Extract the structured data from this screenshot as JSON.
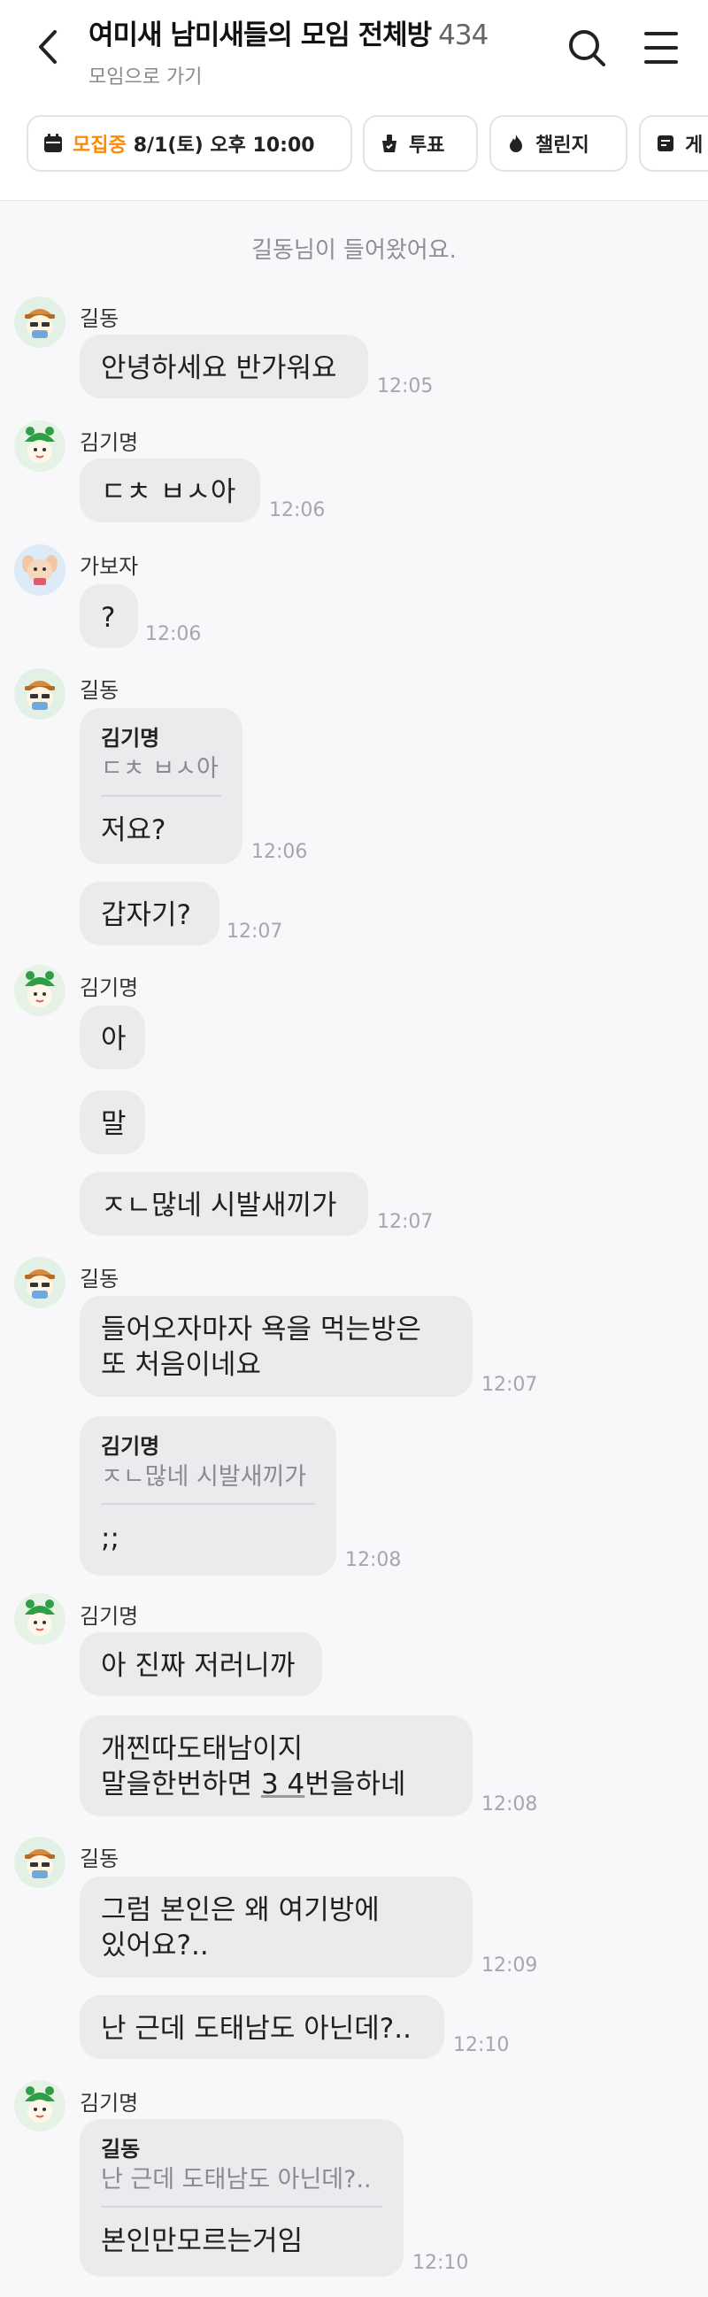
{
  "header": {
    "title": "여미새 남미새들의 모임 전체방",
    "member_count": "434",
    "subtitle": "모임으로 가기"
  },
  "chips": [
    {
      "highlight": "모집중",
      "label": "8/1(토) 오후 10:00",
      "icon": "calendar-icon"
    },
    {
      "label": "투표",
      "icon": "vote-icon"
    },
    {
      "label": "챌린지",
      "icon": "flame-icon"
    },
    {
      "label": "게",
      "icon": "board-icon"
    }
  ],
  "system_message": "길동님이 들어왔어요.",
  "messages": [
    {
      "sender": "길동",
      "text": "안녕하세요 반가워요",
      "time": "12:05"
    },
    {
      "sender": "김기명",
      "text": "ㄷㅊ ㅂㅅ아",
      "time": "12:06"
    },
    {
      "sender": "가보자",
      "text": "?",
      "time": "12:06"
    },
    {
      "sender": "길동",
      "reply_to": "김기명",
      "reply_text": "ㄷㅊ ㅂㅅ아",
      "text": "저요?",
      "time": "12:06"
    },
    {
      "sender": "길동",
      "text": "갑자기?",
      "time": "12:07"
    },
    {
      "sender": "김기명",
      "text": "아"
    },
    {
      "sender": "김기명",
      "text": "말"
    },
    {
      "sender": "김기명",
      "text": "ㅈㄴ많네 시발새끼가",
      "time": "12:07"
    },
    {
      "sender": "길동",
      "text_line1": "들어오자마자 욕을 먹는방은",
      "text_line2": "또 처음이네요",
      "time": "12:07"
    },
    {
      "sender": "길동",
      "reply_to": "김기명",
      "reply_text": "ㅈㄴ많네 시발새끼가",
      "text": ";;",
      "time": "12:08"
    },
    {
      "sender": "김기명",
      "text": "아 진짜 저러니까"
    },
    {
      "sender": "김기명",
      "text_line1": "개찐따도태남이지",
      "text_line2_a": "말을한번하면 ",
      "text_line2_b": "3 4",
      "text_line2_c": "번을하네",
      "time": "12:08"
    },
    {
      "sender": "길동",
      "text_line1": "그럼 본인은 왜 여기방에",
      "text_line2": "있어요?..",
      "time": "12:09"
    },
    {
      "sender": "길동",
      "text": "난 근데 도태남도 아닌데?..",
      "time": "12:10"
    },
    {
      "sender": "김기명",
      "reply_to": "길동",
      "reply_text": "난 근데 도태남도 아닌데?..",
      "text": "본인만모르는거임",
      "time": "12:10"
    }
  ]
}
